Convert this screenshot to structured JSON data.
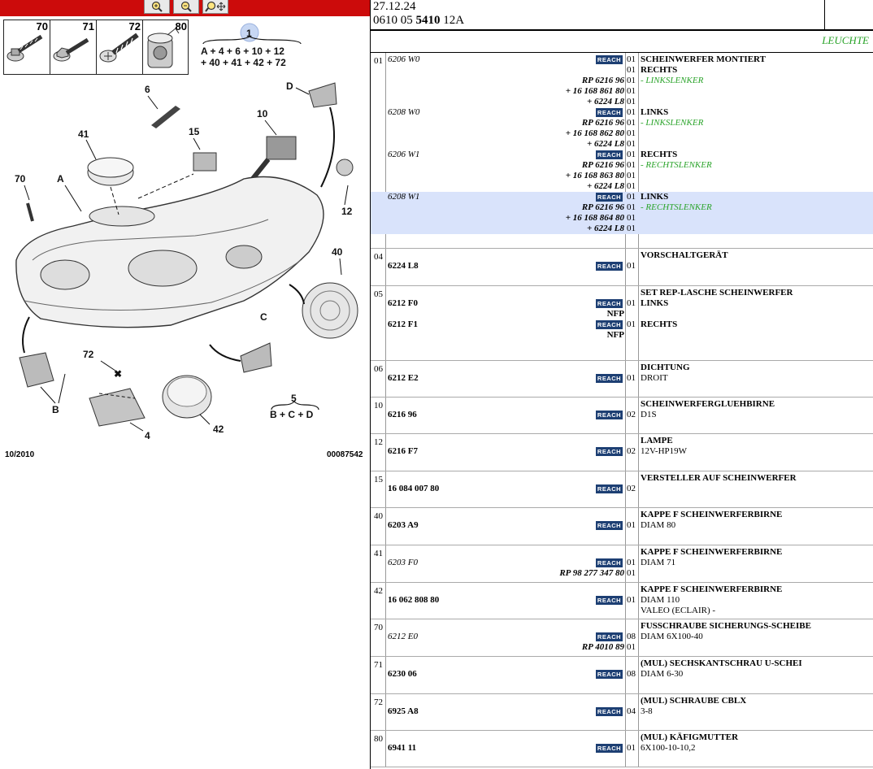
{
  "toolbar": {
    "zoom_in_icon": "zoom-in-icon",
    "zoom_out_icon": "zoom-out-icon",
    "zoom_pan_icon": "zoom-pan-icon",
    "color": "#cc0b0b"
  },
  "thumbnails": [
    "70",
    "71",
    "72",
    "80"
  ],
  "diagram": {
    "group1_number": "1",
    "group1_line1": "A + 4 + 6 + 10 + 12",
    "group1_line2": "+ 40 + 41 + 42 + 72",
    "group5_number": "5",
    "group5_line": "B + C + D",
    "labels": [
      "6",
      "41",
      "15",
      "10",
      "D",
      "70",
      "A",
      "12",
      "40",
      "C",
      "72",
      "B",
      "4",
      "42"
    ],
    "footer_date": "10/2010",
    "footer_code": "00087542"
  },
  "header": {
    "date": "27.12.24",
    "ref_prefix": "0610 05 ",
    "ref_bold": "5410",
    "ref_suffix": " 12A"
  },
  "category": "LEUCHTE",
  "reach_label": "REACH",
  "groups": [
    {
      "num": "01",
      "rows": [
        {
          "ref": "6206 W0",
          "ref_style": "it",
          "reach": true,
          "qty": "01",
          "desc": "SCHEINWERFER MONTIERT",
          "desc_style": "b"
        },
        {
          "qty": "01",
          "desc": "RECHTS",
          "desc_style": "b"
        },
        {
          "alt": "RP 6216 96",
          "qty": "01",
          "desc": "- LINKSLENKER",
          "desc_style": "g"
        },
        {
          "alt": "+ 16 168 861 80",
          "qty": "01"
        },
        {
          "alt": "+ 6224 L8",
          "qty": "01"
        },
        {
          "ref": "6208 W0",
          "ref_style": "it",
          "reach": true,
          "qty": "01",
          "desc": "LINKS",
          "desc_style": "b"
        },
        {
          "alt": "RP 6216 96",
          "qty": "01",
          "desc": "- LINKSLENKER",
          "desc_style": "g"
        },
        {
          "alt": "+ 16 168 862 80",
          "qty": "01"
        },
        {
          "alt": "+ 6224 L8",
          "qty": "01"
        },
        {
          "ref": "6206 W1",
          "ref_style": "it",
          "reach": true,
          "qty": "01",
          "desc": "RECHTS",
          "desc_style": "b"
        },
        {
          "alt": "RP 6216 96",
          "qty": "01",
          "desc": "- RECHTSLENKER",
          "desc_style": "g"
        },
        {
          "alt": "+ 16 168 863 80",
          "qty": "01"
        },
        {
          "alt": "+ 6224 L8",
          "qty": "01"
        },
        {
          "ref": "6208 W1",
          "ref_style": "it",
          "reach": true,
          "qty": "01",
          "desc": "LINKS",
          "desc_style": "b",
          "hl": true
        },
        {
          "alt": "RP 6216 96",
          "qty": "01",
          "desc": "- RECHTSLENKER",
          "desc_style": "g",
          "hl": true
        },
        {
          "alt": "+ 16 168 864 80",
          "qty": "01",
          "hl": true
        },
        {
          "alt": "+ 6224 L8",
          "qty": "01",
          "hl": true
        }
      ]
    },
    {
      "num": "04",
      "rows": [
        {
          "desc": "VORSCHALTGERÄT",
          "desc_style": "b"
        },
        {
          "ref": "6224 L8",
          "ref_style": "bd",
          "reach": true,
          "qty": "01"
        }
      ]
    },
    {
      "num": "05",
      "rows": [
        {
          "desc": "SET REP-LASCHE SCHEINWERFER",
          "desc_style": "b"
        },
        {
          "ref": "6212 F0",
          "ref_style": "bd",
          "reach": true,
          "qty": "01",
          "desc": "LINKS",
          "desc_style": "b"
        },
        {
          "nfp": "NFP"
        },
        {
          "ref": "6212 F1",
          "ref_style": "bd",
          "reach": true,
          "qty": "01",
          "desc": "RECHTS",
          "desc_style": "b"
        },
        {
          "nfp": "NFP"
        }
      ]
    },
    {
      "num": "06",
      "rows": [
        {
          "desc": "DICHTUNG",
          "desc_style": "b"
        },
        {
          "ref": "6212 E2",
          "ref_style": "bd",
          "reach": true,
          "qty": "01",
          "desc": "DROIT"
        }
      ]
    },
    {
      "num": "10",
      "rows": [
        {
          "desc": "SCHEINWERFERGLUEHBIRNE",
          "desc_style": "b"
        },
        {
          "ref": "6216 96",
          "ref_style": "bd",
          "reach": true,
          "qty": "02",
          "desc": "D1S"
        }
      ]
    },
    {
      "num": "12",
      "rows": [
        {
          "desc": "LAMPE",
          "desc_style": "b"
        },
        {
          "ref": "6216 F7",
          "ref_style": "bd",
          "reach": true,
          "qty": "02",
          "desc": "12V-HP19W"
        }
      ]
    },
    {
      "num": "15",
      "rows": [
        {
          "desc": "VERSTELLER AUF SCHEINWERFER",
          "desc_style": "b"
        },
        {
          "ref": "16 084 007 80",
          "ref_style": "bd",
          "reach": true,
          "qty": "02"
        }
      ]
    },
    {
      "num": "40",
      "rows": [
        {
          "desc": "KAPPE F SCHEINWERFERBIRNE",
          "desc_style": "b"
        },
        {
          "ref": "6203 A9",
          "ref_style": "bd",
          "reach": true,
          "qty": "01",
          "desc": "DIAM 80"
        }
      ]
    },
    {
      "num": "41",
      "rows": [
        {
          "desc": "KAPPE F SCHEINWERFERBIRNE",
          "desc_style": "b"
        },
        {
          "ref": "6203 F0",
          "ref_style": "it",
          "reach": true,
          "qty": "01",
          "desc": "DIAM 71"
        },
        {
          "alt": "RP 98 277 347 80",
          "qty": "01"
        }
      ]
    },
    {
      "num": "42",
      "rows": [
        {
          "desc": "KAPPE F SCHEINWERFERBIRNE",
          "desc_style": "b"
        },
        {
          "ref": "16 062 808 80",
          "ref_style": "bd",
          "reach": true,
          "qty": "01",
          "desc": "DIAM 110"
        },
        {
          "desc": "VALEO (ECLAIR) -"
        }
      ]
    },
    {
      "num": "70",
      "rows": [
        {
          "desc": "FUSSCHRAUBE SICHERUNGS-SCHEIBE",
          "desc_style": "b"
        },
        {
          "ref": "6212 E0",
          "ref_style": "it",
          "reach": true,
          "qty": "08",
          "desc": "DIAM 6X100-40"
        },
        {
          "alt": "RP 4010 89",
          "qty": "01"
        }
      ]
    },
    {
      "num": "71",
      "rows": [
        {
          "desc": "(MUL) SECHSKANTSCHRAU U-SCHEI",
          "desc_style": "b"
        },
        {
          "ref": "6230 06",
          "ref_style": "bd",
          "reach": true,
          "qty": "08",
          "desc": "DIAM 6-30"
        }
      ]
    },
    {
      "num": "72",
      "rows": [
        {
          "desc": "(MUL) SCHRAUBE CBLX",
          "desc_style": "b"
        },
        {
          "ref": "6925 A8",
          "ref_style": "bd",
          "reach": true,
          "qty": "04",
          "desc": "3-8"
        }
      ]
    },
    {
      "num": "80",
      "rows": [
        {
          "desc": "(MUL) KÄFIGMUTTER",
          "desc_style": "b"
        },
        {
          "ref": "6941 11",
          "ref_style": "bd",
          "reach": true,
          "qty": "01",
          "desc": "6X100-10-10,2"
        }
      ]
    }
  ]
}
